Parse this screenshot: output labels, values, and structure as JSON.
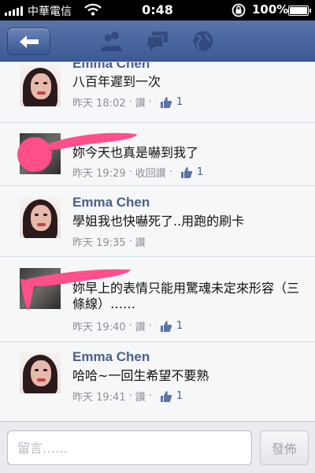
{
  "status_bar": {
    "carrier": "中華電信",
    "time": "0:48",
    "battery_percent": "100%"
  },
  "header": {
    "back_icon": "back-arrow-icon",
    "nav_icons": [
      "friends-icon",
      "messages-icon",
      "globe-icon"
    ]
  },
  "comments": [
    {
      "author": "Emma Chen",
      "text": "八百年遲到一次",
      "time": "昨天 18:02",
      "action": "讚",
      "likes": "1",
      "avatar": "emma"
    },
    {
      "author": "",
      "text": "妳今天也真是嚇到我了",
      "time": "昨天 19:29",
      "action": "收回讚",
      "likes": "1",
      "avatar": "redacted"
    },
    {
      "author": "Emma Chen",
      "text": "學姐我也快嚇死了..用跑的刷卡",
      "time": "昨天 19:35",
      "action": "讚",
      "likes": "",
      "avatar": "emma"
    },
    {
      "author": "",
      "text": "妳早上的表情只能用驚魂未定來形容（三條線）……",
      "time": "昨天 19:40",
      "action": "讚",
      "likes": "1",
      "avatar": "redacted"
    },
    {
      "author": "Emma Chen",
      "text": "哈哈~一回生希望不要熟",
      "time": "昨天 19:41",
      "action": "讚",
      "likes": "1",
      "avatar": "emma"
    }
  ],
  "composer": {
    "placeholder": "留言……",
    "submit_label": "發佈"
  },
  "colors": {
    "header_blue": "#3d5a96",
    "name_blue": "#4b5f8f",
    "scribble_red": "#ff4f8a"
  }
}
